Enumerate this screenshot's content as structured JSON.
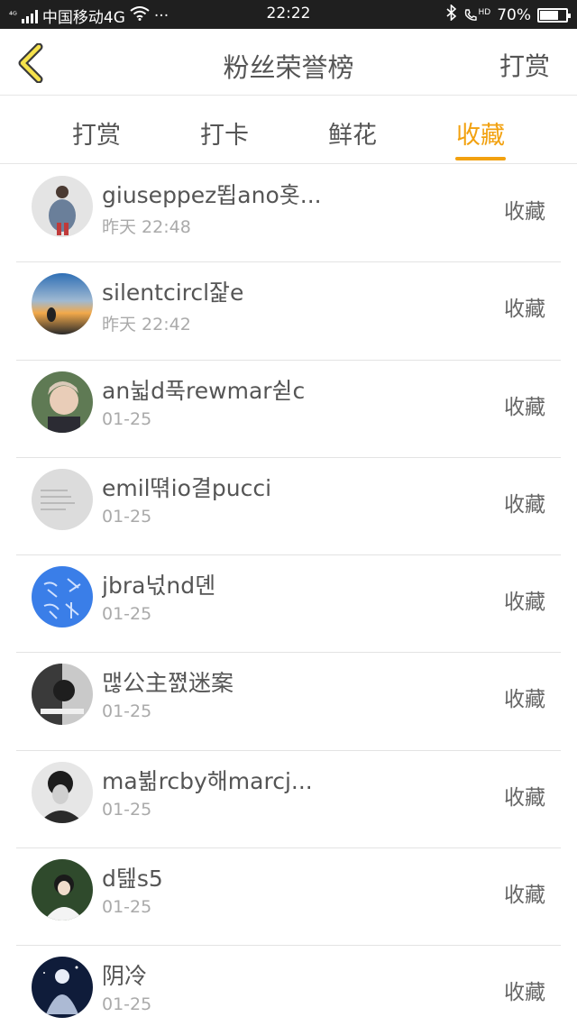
{
  "status_bar": {
    "network": "⁴ᴳ",
    "carrier": "中国移动4G",
    "more": "···",
    "time": "22:22",
    "hd": "HD",
    "battery": "70%",
    "battery_level": 0.7
  },
  "header": {
    "title": "粉丝荣誉榜",
    "action_label": "打赏",
    "accent_color": "#f2a10f"
  },
  "tabs": [
    {
      "label": "打赏",
      "active": false
    },
    {
      "label": "打卡",
      "active": false
    },
    {
      "label": "鲜花",
      "active": false
    },
    {
      "label": "收藏",
      "active": true
    }
  ],
  "list": {
    "items": [
      {
        "name": "giuseppez뙵ano홋...",
        "time": "昨天 22:48",
        "action": "收藏",
        "avatar": "avatar-photo-person"
      },
      {
        "name": "silentcircl잝e",
        "time": "昨天 22:42",
        "action": "收藏",
        "avatar": "avatar-photo-sunset"
      },
      {
        "name": "an뉣d푹rewmar쉳c",
        "time": "01-25",
        "action": "收藏",
        "avatar": "avatar-photo-boy"
      },
      {
        "name": "emil뗚io결pucci",
        "time": "01-25",
        "action": "收藏",
        "avatar": "avatar-text-gray"
      },
      {
        "name": "jbra넋nd뎬",
        "time": "01-25",
        "action": "收藏",
        "avatar": "avatar-blue-calligraphy"
      },
      {
        "name": "맪公主쪐迷案",
        "time": "01-25",
        "action": "收藏",
        "avatar": "avatar-photo-mono"
      },
      {
        "name": "ma뷞rcby해marcj...",
        "time": "01-25",
        "action": "收藏",
        "avatar": "avatar-photo-dark"
      },
      {
        "name": "d텚s5",
        "time": "01-25",
        "action": "收藏",
        "avatar": "avatar-photo-girl"
      },
      {
        "name": "阴冷",
        "time": "01-25",
        "action": "收藏",
        "avatar": "avatar-photo-night"
      }
    ]
  }
}
